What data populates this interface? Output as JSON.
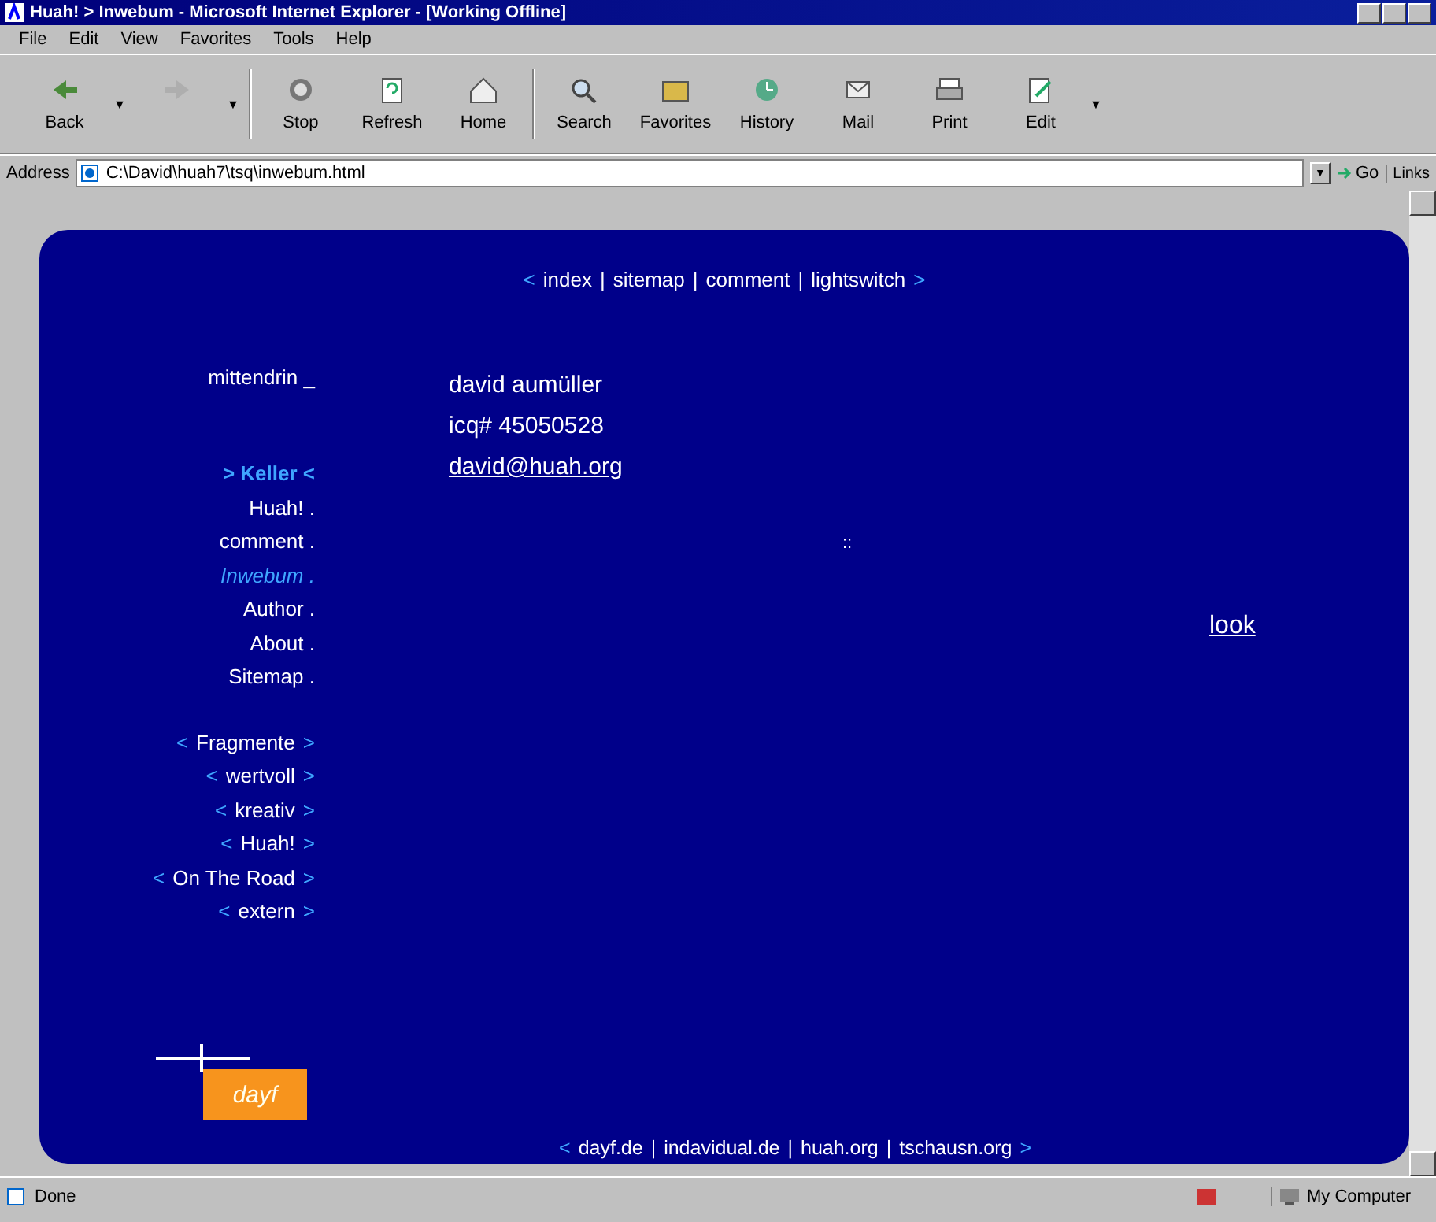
{
  "window": {
    "title": "Huah! > Inwebum - Microsoft Internet Explorer - [Working Offline]"
  },
  "menu": [
    "File",
    "Edit",
    "View",
    "Favorites",
    "Tools",
    "Help"
  ],
  "toolbar": [
    {
      "label": "Back",
      "disabled": false,
      "caret": "▼"
    },
    {
      "disabled": true,
      "caret": "▼"
    },
    {
      "label": "Stop",
      "disabled": false
    },
    {
      "label": "Refresh",
      "disabled": false
    },
    {
      "label": "Home",
      "disabled": false
    },
    {
      "label": "Search",
      "disabled": false
    },
    {
      "label": "Favorites",
      "disabled": false
    },
    {
      "label": "History",
      "disabled": false
    },
    {
      "label": "Mail",
      "disabled": false
    },
    {
      "label": "Print",
      "disabled": false
    },
    {
      "label": "Edit",
      "disabled": false,
      "caret": "▼"
    }
  ],
  "address": {
    "label": "Address",
    "value": "C:\\David\\huah7\\tsq\\inwebum.html",
    "caret": "▼",
    "go": "Go",
    "links": "Links"
  },
  "page": {
    "top_nav": [
      {
        "kind": "bracket",
        "text": "<"
      },
      {
        "kind": "link",
        "text": "index"
      },
      {
        "kind": "separator",
        "text": "|"
      },
      {
        "kind": "link",
        "text": "sitemap"
      },
      {
        "kind": "separator",
        "text": "|"
      },
      {
        "kind": "link",
        "text": "comment"
      },
      {
        "kind": "separator",
        "text": "|"
      },
      {
        "kind": "link",
        "text": "lightswitch"
      },
      {
        "kind": "bracket",
        "text": ">"
      }
    ],
    "sidebar": {
      "title": "mittendrin _",
      "items": [
        {
          "label": "> Keller <",
          "kind": "heading",
          "selected": false
        },
        {
          "label": "Huah! .",
          "kind": "link",
          "selected": false
        },
        {
          "label": "comment .",
          "kind": "link",
          "selected": false
        },
        {
          "label": "Inwebum .",
          "kind": "link",
          "selected": true
        },
        {
          "label": "Author .",
          "kind": "link",
          "selected": false
        },
        {
          "label": "About .",
          "kind": "link",
          "selected": false
        },
        {
          "label": "Sitemap .",
          "kind": "link",
          "selected": false
        }
      ],
      "sections": [
        {
          "open": "<",
          "label": "Fragmente",
          "close": ">"
        },
        {
          "open": "<",
          "label": "wertvoll",
          "close": ">"
        },
        {
          "open": "<",
          "label": "kreativ",
          "close": ">"
        },
        {
          "open": "<",
          "label": "Huah!",
          "close": ">"
        },
        {
          "open": "<",
          "label": "On The Road",
          "close": ">"
        },
        {
          "open": "<",
          "label": "extern",
          "close": ">"
        }
      ]
    },
    "contact": {
      "name": "david aumüller",
      "icq": "icq# 45050528",
      "email": "david@huah.org"
    },
    "marker": "::",
    "look": "look",
    "logo": "dayf",
    "footer": [
      {
        "kind": "bracket",
        "text": "<"
      },
      {
        "kind": "link",
        "text": "dayf.de"
      },
      {
        "kind": "separator",
        "text": "|"
      },
      {
        "kind": "link",
        "text": "indavidual.de"
      },
      {
        "kind": "separator",
        "text": "|"
      },
      {
        "kind": "link",
        "text": "huah.org"
      },
      {
        "kind": "separator",
        "text": "|"
      },
      {
        "kind": "link",
        "text": "tschausn.org"
      },
      {
        "kind": "bracket",
        "text": ">"
      }
    ]
  },
  "status_bar": {
    "text": "Done",
    "zone": "My Computer"
  }
}
